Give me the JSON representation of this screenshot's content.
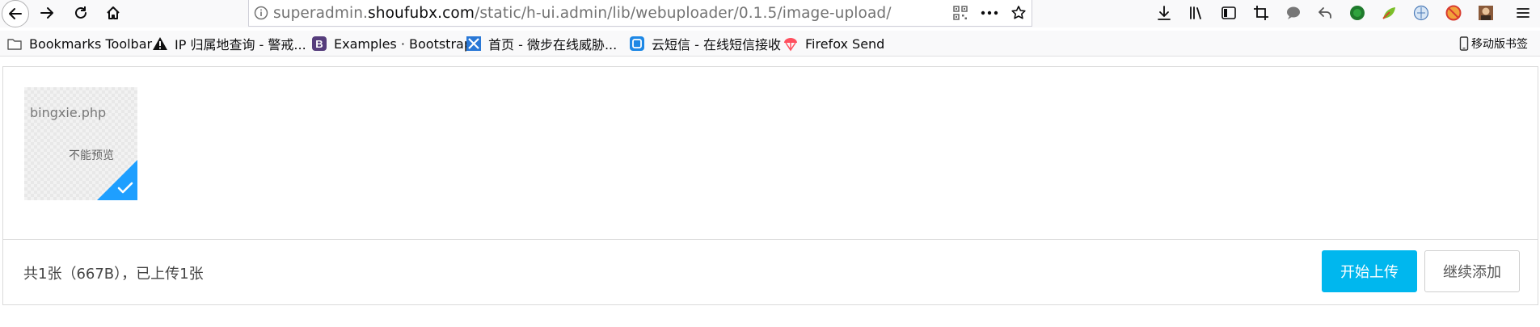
{
  "browser": {
    "url": {
      "prefix": "superadmin.",
      "host": "shoufubx.com",
      "path": "/static/h-ui.admin/lib/webuploader/0.1.5/image-upload/"
    },
    "bookmarks": [
      {
        "label": "Bookmarks Toolbar",
        "icon": "folder-icon"
      },
      {
        "label": "IP 归属地查询 - 警戒...",
        "icon": "warning-icon"
      },
      {
        "label": "Examples · Bootstrap",
        "icon": "bootstrap-icon"
      },
      {
        "label": "首页 - 微步在线威胁...",
        "icon": "threatbook-icon"
      },
      {
        "label": "云短信 - 在线短信接收",
        "icon": "sms-icon"
      },
      {
        "label": "Firefox Send",
        "icon": "firefox-send-icon"
      }
    ],
    "mobile_bookmarks": "移动版书签"
  },
  "uploader": {
    "file": {
      "name": "bingxie.php",
      "preview_message": "不能预览"
    },
    "status_text": "共1张（667B），已上传1张",
    "start_upload_label": "开始上传",
    "continue_add_label": "继续添加"
  },
  "colors": {
    "primary_button": "#00b7ee",
    "success_corner": "#1e9fff"
  }
}
